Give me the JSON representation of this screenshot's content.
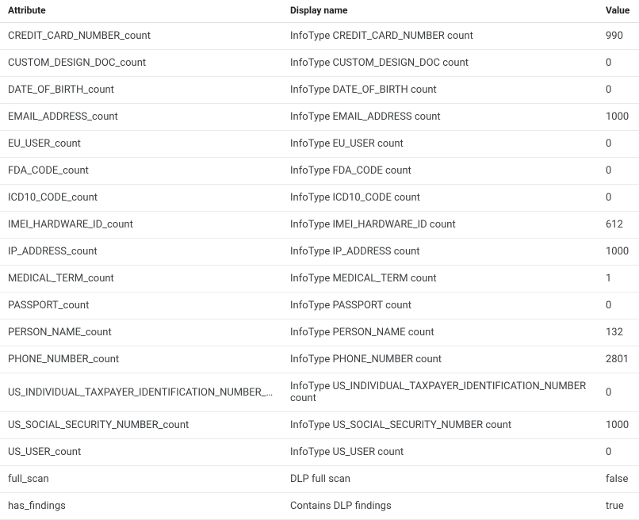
{
  "table": {
    "headers": {
      "attribute": "Attribute",
      "display_name": "Display name",
      "value": "Value"
    },
    "rows": [
      {
        "attribute": "CREDIT_CARD_NUMBER_count",
        "display_name": "InfoType CREDIT_CARD_NUMBER count",
        "value": "990"
      },
      {
        "attribute": "CUSTOM_DESIGN_DOC_count",
        "display_name": "InfoType CUSTOM_DESIGN_DOC count",
        "value": "0"
      },
      {
        "attribute": "DATE_OF_BIRTH_count",
        "display_name": "InfoType DATE_OF_BIRTH count",
        "value": "0"
      },
      {
        "attribute": "EMAIL_ADDRESS_count",
        "display_name": "InfoType EMAIL_ADDRESS count",
        "value": "1000"
      },
      {
        "attribute": "EU_USER_count",
        "display_name": "InfoType EU_USER count",
        "value": "0"
      },
      {
        "attribute": "FDA_CODE_count",
        "display_name": "InfoType FDA_CODE count",
        "value": "0"
      },
      {
        "attribute": "ICD10_CODE_count",
        "display_name": "InfoType ICD10_CODE count",
        "value": "0"
      },
      {
        "attribute": "IMEI_HARDWARE_ID_count",
        "display_name": "InfoType IMEI_HARDWARE_ID count",
        "value": "612"
      },
      {
        "attribute": "IP_ADDRESS_count",
        "display_name": "InfoType IP_ADDRESS count",
        "value": "1000"
      },
      {
        "attribute": "MEDICAL_TERM_count",
        "display_name": "InfoType MEDICAL_TERM count",
        "value": "1"
      },
      {
        "attribute": "PASSPORT_count",
        "display_name": "InfoType PASSPORT count",
        "value": "0"
      },
      {
        "attribute": "PERSON_NAME_count",
        "display_name": "InfoType PERSON_NAME count",
        "value": "132"
      },
      {
        "attribute": "PHONE_NUMBER_count",
        "display_name": "InfoType PHONE_NUMBER count",
        "value": "2801"
      },
      {
        "attribute": "US_INDIVIDUAL_TAXPAYER_IDENTIFICATION_NUMBER_count",
        "display_name": "InfoType US_INDIVIDUAL_TAXPAYER_IDENTIFICATION_NUMBER count",
        "value": "0"
      },
      {
        "attribute": "US_SOCIAL_SECURITY_NUMBER_count",
        "display_name": "InfoType US_SOCIAL_SECURITY_NUMBER count",
        "value": "1000"
      },
      {
        "attribute": "US_USER_count",
        "display_name": "InfoType US_USER count",
        "value": "0"
      },
      {
        "attribute": "full_scan",
        "display_name": "DLP full scan",
        "value": "false"
      },
      {
        "attribute": "has_findings",
        "display_name": "Contains DLP findings",
        "value": "true"
      }
    ]
  }
}
